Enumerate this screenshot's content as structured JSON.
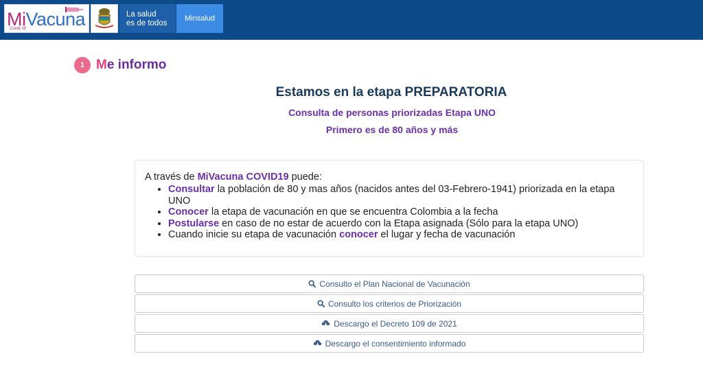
{
  "header": {
    "logo_mi": "Mi",
    "logo_vacuna": "Vacuna",
    "logo_sub": "Covid-19",
    "brand_line1": "La salud",
    "brand_line2": "es de todos",
    "ministry": "Minsalud"
  },
  "section": {
    "step_number": "1",
    "title_first": "M",
    "title_rest": "e informo"
  },
  "stage": {
    "heading": "Estamos en la etapa PREPARATORIA",
    "subheading1": "Consulta de personas priorizadas Etapa UNO",
    "subheading2": "Primero es de 80 años y más"
  },
  "info": {
    "intro_before": "A través de ",
    "intro_highlight": "MiVacuna COVID19",
    "intro_after": " puede:",
    "items": [
      {
        "highlight": "Consultar",
        "text": " la población de 80 y mas años (nacidos antes del 03-Febrero-1941) priorizada en la etapa UNO"
      },
      {
        "highlight": "Conocer",
        "text": " la etapa de vacunación en que se encuentra Colombia a la fecha"
      },
      {
        "highlight": "Postularse",
        "text": " en caso de no estar de acuerdo con la Etapa asignada (Sólo para la etapa UNO)"
      },
      {
        "before": "Cuando inicie su etapa de vacunación ",
        "highlight": "conocer",
        "text": " el lugar y fecha de vacunación"
      }
    ]
  },
  "actions": [
    {
      "label": "Consulto el Plan Nacional de Vacunación",
      "icon": "search-icon"
    },
    {
      "label": "Consulto los criterios de Priorización",
      "icon": "search-icon"
    },
    {
      "label": "Descargo el Decreto 109 de 2021",
      "icon": "cloud-download-icon"
    },
    {
      "label": "Descargo el consentimiento informado",
      "icon": "cloud-download-icon"
    }
  ],
  "colors": {
    "topbar": "#0c4a8a",
    "accent_purple": "#6b2fa8",
    "accent_pink": "#ec6a8c"
  }
}
